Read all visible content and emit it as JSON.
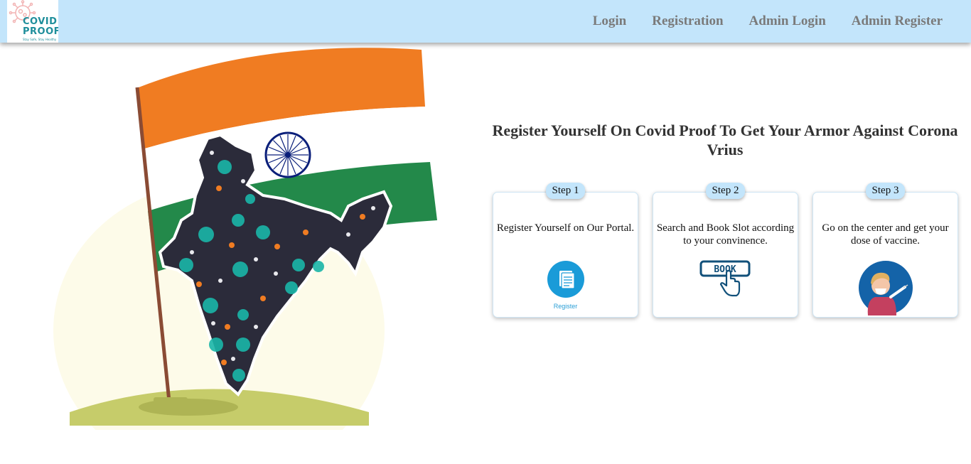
{
  "brand": {
    "name_line1": "COVID",
    "name_line2": "PROOF",
    "tagline": "Stay Safe, Stay Healthy",
    "logo_icon": "virus-icon"
  },
  "nav": {
    "items": [
      {
        "label": "Login"
      },
      {
        "label": "Registration"
      },
      {
        "label": "Admin Login"
      },
      {
        "label": "Admin Register"
      }
    ]
  },
  "hero": {
    "illustration": "india-map-flag-illustration",
    "headline": "Register Yourself On Covid Proof To Get Your Armor Against Corona Vrius"
  },
  "steps": [
    {
      "badge": "Step 1",
      "text": "Register Yourself on Our Portal.",
      "icon": "register-document-icon",
      "caption": "Register"
    },
    {
      "badge": "Step 2",
      "text": "Search and Book Slot according to your convinence.",
      "icon": "book-click-icon"
    },
    {
      "badge": "Step 3",
      "text": "Go on the center and get your dose of vaccine.",
      "icon": "vaccination-icon"
    }
  ],
  "colors": {
    "navbar": "#c3e5fb",
    "saffron": "#f07c22",
    "green": "#23894a",
    "chakra": "#0a1f7a",
    "accent_teal": "#1e8e9b"
  }
}
